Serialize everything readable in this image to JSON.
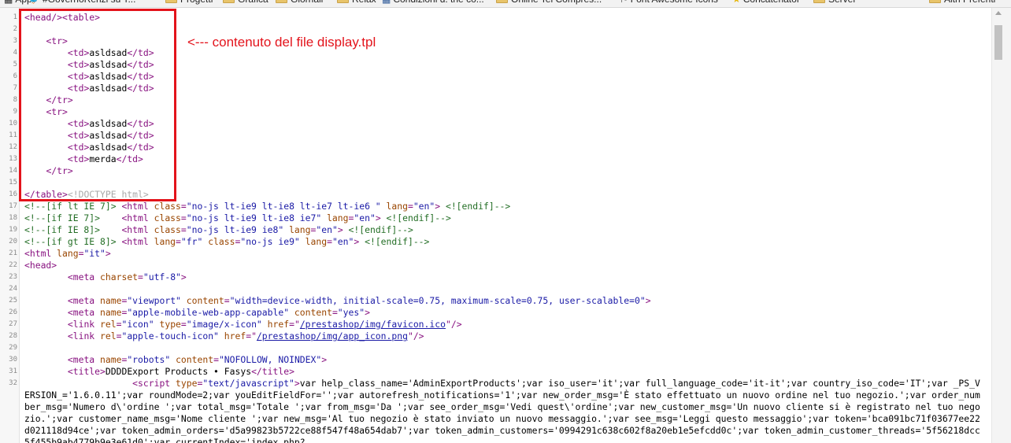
{
  "bookmarks_bar": {
    "items": [
      {
        "label": "App",
        "icon": "apps-grid-icon"
      },
      {
        "label": "#GovernoRenzi su T...",
        "icon": "twitter-bird-icon"
      },
      {
        "label": "Progetti",
        "icon": "folder-icon"
      },
      {
        "label": "Grafica",
        "icon": "folder-icon"
      },
      {
        "label": "Giornali",
        "icon": "folder-icon"
      },
      {
        "label": "Relax",
        "icon": "folder-icon"
      },
      {
        "label": "Condizioni d. the co...",
        "icon": "site-favicon-icon"
      },
      {
        "label": "Online Tel Compres...",
        "icon": "folder-icon"
      },
      {
        "label": "Font Awesome Icons",
        "icon": "flag-icon"
      },
      {
        "label": "Concatenator",
        "icon": "star-icon"
      },
      {
        "label": "Server",
        "icon": "folder-icon"
      },
      {
        "label": "Altri Preferiti",
        "icon": "folder-icon"
      }
    ]
  },
  "annotation": {
    "text": "<--- contenuto del file display.tpl",
    "color": "#e3131b"
  },
  "source": {
    "lines": [
      {
        "num": "1",
        "segs": [
          [
            "tag",
            "<head/><table>"
          ]
        ]
      },
      {
        "num": "2",
        "segs": []
      },
      {
        "num": "3",
        "segs": [
          [
            "t",
            "    "
          ],
          [
            "tag",
            "<tr>"
          ]
        ]
      },
      {
        "num": "4",
        "segs": [
          [
            "t",
            "        "
          ],
          [
            "tag",
            "<td>"
          ],
          [
            "t",
            "asldsad"
          ],
          [
            "tag",
            "</td>"
          ]
        ]
      },
      {
        "num": "5",
        "segs": [
          [
            "t",
            "        "
          ],
          [
            "tag",
            "<td>"
          ],
          [
            "t",
            "asldsad"
          ],
          [
            "tag",
            "</td>"
          ]
        ]
      },
      {
        "num": "6",
        "segs": [
          [
            "t",
            "        "
          ],
          [
            "tag",
            "<td>"
          ],
          [
            "t",
            "asldsad"
          ],
          [
            "tag",
            "</td>"
          ]
        ]
      },
      {
        "num": "7",
        "segs": [
          [
            "t",
            "        "
          ],
          [
            "tag",
            "<td>"
          ],
          [
            "t",
            "asldsad"
          ],
          [
            "tag",
            "</td>"
          ]
        ]
      },
      {
        "num": "8",
        "segs": [
          [
            "t",
            "    "
          ],
          [
            "tag",
            "</tr>"
          ]
        ]
      },
      {
        "num": "9",
        "segs": [
          [
            "t",
            "    "
          ],
          [
            "tag",
            "<tr>"
          ]
        ]
      },
      {
        "num": "10",
        "segs": [
          [
            "t",
            "        "
          ],
          [
            "tag",
            "<td>"
          ],
          [
            "t",
            "asldsad"
          ],
          [
            "tag",
            "</td>"
          ]
        ]
      },
      {
        "num": "11",
        "segs": [
          [
            "t",
            "        "
          ],
          [
            "tag",
            "<td>"
          ],
          [
            "t",
            "asldsad"
          ],
          [
            "tag",
            "</td>"
          ]
        ]
      },
      {
        "num": "12",
        "segs": [
          [
            "t",
            "        "
          ],
          [
            "tag",
            "<td>"
          ],
          [
            "t",
            "asldsad"
          ],
          [
            "tag",
            "</td>"
          ]
        ]
      },
      {
        "num": "13",
        "segs": [
          [
            "t",
            "        "
          ],
          [
            "tag",
            "<td>"
          ],
          [
            "t",
            "merda"
          ],
          [
            "tag",
            "</td>"
          ]
        ]
      },
      {
        "num": "14",
        "segs": [
          [
            "t",
            "    "
          ],
          [
            "tag",
            "</tr>"
          ]
        ]
      },
      {
        "num": "15",
        "segs": []
      },
      {
        "num": "16",
        "segs": [
          [
            "tag",
            "</table>"
          ],
          [
            "gray",
            "<!DOCTYPE html>"
          ]
        ]
      },
      {
        "num": "17",
        "segs": [
          [
            "cm",
            "<!--[if lt IE 7]> "
          ],
          [
            "tag",
            "<html "
          ],
          [
            "an",
            "class"
          ],
          [
            "tag",
            "="
          ],
          [
            "av",
            "\"no-js lt-ie9 lt-ie8 lt-ie7 lt-ie6 \""
          ],
          [
            "t",
            " "
          ],
          [
            "an",
            "lang"
          ],
          [
            "tag",
            "="
          ],
          [
            "av",
            "\"en\""
          ],
          [
            "tag",
            "> "
          ],
          [
            "cm",
            "<![endif]-->"
          ]
        ]
      },
      {
        "num": "18",
        "segs": [
          [
            "cm",
            "<!--[if IE 7]>    "
          ],
          [
            "tag",
            "<html "
          ],
          [
            "an",
            "class"
          ],
          [
            "tag",
            "="
          ],
          [
            "av",
            "\"no-js lt-ie9 lt-ie8 ie7\""
          ],
          [
            "t",
            " "
          ],
          [
            "an",
            "lang"
          ],
          [
            "tag",
            "="
          ],
          [
            "av",
            "\"en\""
          ],
          [
            "tag",
            "> "
          ],
          [
            "cm",
            "<![endif]-->"
          ]
        ]
      },
      {
        "num": "19",
        "segs": [
          [
            "cm",
            "<!--[if IE 8]>    "
          ],
          [
            "tag",
            "<html "
          ],
          [
            "an",
            "class"
          ],
          [
            "tag",
            "="
          ],
          [
            "av",
            "\"no-js lt-ie9 ie8\""
          ],
          [
            "t",
            " "
          ],
          [
            "an",
            "lang"
          ],
          [
            "tag",
            "="
          ],
          [
            "av",
            "\"en\""
          ],
          [
            "tag",
            "> "
          ],
          [
            "cm",
            "<![endif]-->"
          ]
        ]
      },
      {
        "num": "20",
        "segs": [
          [
            "cm",
            "<!--[if gt IE 8]> "
          ],
          [
            "tag",
            "<html "
          ],
          [
            "an",
            "lang"
          ],
          [
            "tag",
            "="
          ],
          [
            "av",
            "\"fr\""
          ],
          [
            "t",
            " "
          ],
          [
            "an",
            "class"
          ],
          [
            "tag",
            "="
          ],
          [
            "av",
            "\"no-js ie9\""
          ],
          [
            "t",
            " "
          ],
          [
            "an",
            "lang"
          ],
          [
            "tag",
            "="
          ],
          [
            "av",
            "\"en\""
          ],
          [
            "tag",
            "> "
          ],
          [
            "cm",
            "<![endif]-->"
          ]
        ]
      },
      {
        "num": "21",
        "segs": [
          [
            "tag",
            "<html "
          ],
          [
            "an",
            "lang"
          ],
          [
            "tag",
            "="
          ],
          [
            "av",
            "\"it\""
          ],
          [
            "tag",
            ">"
          ]
        ]
      },
      {
        "num": "22",
        "segs": [
          [
            "tag",
            "<head>"
          ]
        ]
      },
      {
        "num": "23",
        "segs": [
          [
            "t",
            "        "
          ],
          [
            "tag",
            "<meta "
          ],
          [
            "an",
            "charset"
          ],
          [
            "tag",
            "="
          ],
          [
            "av",
            "\"utf-8\""
          ],
          [
            "tag",
            ">"
          ]
        ]
      },
      {
        "num": "24",
        "segs": []
      },
      {
        "num": "25",
        "segs": [
          [
            "t",
            "        "
          ],
          [
            "tag",
            "<meta "
          ],
          [
            "an",
            "name"
          ],
          [
            "tag",
            "="
          ],
          [
            "av",
            "\"viewport\""
          ],
          [
            "t",
            " "
          ],
          [
            "an",
            "content"
          ],
          [
            "tag",
            "="
          ],
          [
            "av",
            "\"width=device-width, initial-scale=0.75, maximum-scale=0.75, user-scalable=0\""
          ],
          [
            "tag",
            ">"
          ]
        ]
      },
      {
        "num": "26",
        "segs": [
          [
            "t",
            "        "
          ],
          [
            "tag",
            "<meta "
          ],
          [
            "an",
            "name"
          ],
          [
            "tag",
            "="
          ],
          [
            "av",
            "\"apple-mobile-web-app-capable\""
          ],
          [
            "t",
            " "
          ],
          [
            "an",
            "content"
          ],
          [
            "tag",
            "="
          ],
          [
            "av",
            "\"yes\""
          ],
          [
            "tag",
            ">"
          ]
        ]
      },
      {
        "num": "27",
        "segs": [
          [
            "t",
            "        "
          ],
          [
            "tag",
            "<link "
          ],
          [
            "an",
            "rel"
          ],
          [
            "tag",
            "="
          ],
          [
            "av",
            "\"icon\""
          ],
          [
            "t",
            " "
          ],
          [
            "an",
            "type"
          ],
          [
            "tag",
            "="
          ],
          [
            "av",
            "\"image/x-icon\""
          ],
          [
            "t",
            " "
          ],
          [
            "an",
            "href"
          ],
          [
            "tag",
            "=\""
          ],
          [
            "link",
            "/prestashop/img/favicon.ico"
          ],
          [
            "tag",
            "\"/>"
          ]
        ]
      },
      {
        "num": "28",
        "segs": [
          [
            "t",
            "        "
          ],
          [
            "tag",
            "<link "
          ],
          [
            "an",
            "rel"
          ],
          [
            "tag",
            "="
          ],
          [
            "av",
            "\"apple-touch-icon\""
          ],
          [
            "t",
            " "
          ],
          [
            "an",
            "href"
          ],
          [
            "tag",
            "=\""
          ],
          [
            "link",
            "/prestashop/img/app_icon.png"
          ],
          [
            "tag",
            "\"/>"
          ]
        ]
      },
      {
        "num": "29",
        "segs": []
      },
      {
        "num": "30",
        "segs": [
          [
            "t",
            "        "
          ],
          [
            "tag",
            "<meta "
          ],
          [
            "an",
            "name"
          ],
          [
            "tag",
            "="
          ],
          [
            "av",
            "\"robots\""
          ],
          [
            "t",
            " "
          ],
          [
            "an",
            "content"
          ],
          [
            "tag",
            "="
          ],
          [
            "av",
            "\"NOFOLLOW, NOINDEX\""
          ],
          [
            "tag",
            ">"
          ]
        ]
      },
      {
        "num": "31",
        "segs": [
          [
            "t",
            "        "
          ],
          [
            "tag",
            "<title>"
          ],
          [
            "t",
            "DDDDExport Products • Fasys"
          ],
          [
            "tag",
            "</title>"
          ]
        ]
      }
    ],
    "line32": {
      "num": "32",
      "segs": [
        [
          "t",
          "                    "
        ],
        [
          "tag",
          "<script "
        ],
        [
          "an",
          "type"
        ],
        [
          "tag",
          "="
        ],
        [
          "av",
          "\"text/javascript\""
        ],
        [
          "tag",
          ">"
        ],
        [
          "t",
          "var help_class_name='AdminExportProducts';var iso_user='it';var full_language_code='it-it';var country_iso_code='IT';var _PS_VERSION_='1.6.0.11';var roundMode=2;var youEditFieldFor='';var autorefresh_notifications='1';var new_order_msg='È stato effettuato un nuovo ordine nel tuo negozio.';var order_number_msg='Numero d\\'ordine ';var total_msg='Totale ';var from_msg='Da ';var see_order_msg='Vedi quest\\'ordine';var new_customer_msg='Un nuovo cliente si è registrato nel tuo negozio.';var customer_name_msg='Nome cliente ';var new_msg='Al tuo negozio è stato inviato un nuovo messaggio.';var see_msg='Leggi questo messaggio';var token='bca091bc71f03677ee22d021118d94ce';var token_admin_orders='d5a99823b5722ce88f547f48a654dab7';var token_admin_customers='0994291c638c602f8a20eb1e5efcdd0c';var token_admin_customer_threads='5f56218dcc5f455b9ab4779b9e3e61d0';var currentIndex='index.php?"
        ]
      ]
    }
  }
}
